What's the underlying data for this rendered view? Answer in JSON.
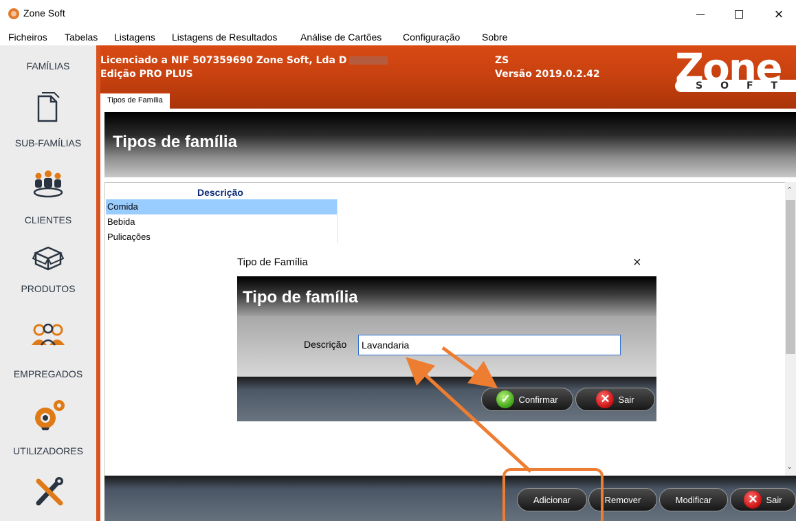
{
  "window": {
    "title": "Zone Soft",
    "controls": {
      "minimize": "minimize",
      "maximize": "maximize",
      "close": "×"
    }
  },
  "menu": [
    "Ficheiros",
    "Tabelas",
    "Listagens",
    "Listagens de Resultados",
    "Análise de Cartões",
    "Configuração",
    "Sobre"
  ],
  "sidebar": {
    "items": [
      {
        "label": "FAMÍLIAS",
        "icon": "document-icon"
      },
      {
        "label": "SUB-FAMÍLIAS",
        "icon": "group-icon"
      },
      {
        "label": "CLIENTES",
        "icon": "box-icon"
      },
      {
        "label": "PRODUTOS",
        "icon": "people-icon"
      },
      {
        "label": "EMPREGADOS",
        "icon": "gears-icon"
      },
      {
        "label": "UTILIZADORES",
        "icon": "tools-icon"
      }
    ]
  },
  "header": {
    "license_line": "Licenciado a NIF 507359690 Zone Soft, Lda D",
    "edition": "Edição PRO PLUS",
    "zs": "ZS",
    "version": "Versão 2019.0.2.42",
    "logo_word": "Zone",
    "logo_sub": "SOFT",
    "tab": "Tipos de Família",
    "accent": "#d94a14"
  },
  "main": {
    "title": "Tipos de família",
    "column": "Descrição",
    "rows": [
      "Comida",
      "Bebida",
      "Pulicações"
    ],
    "selected_index": 0
  },
  "toolbar": {
    "add": "Adicionar",
    "remove": "Remover",
    "modify": "Modificar",
    "exit": "Sair"
  },
  "dialog": {
    "window_title": "Tipo de Família",
    "close": "×",
    "title": "Tipo de família",
    "field_label": "Descrição",
    "field_value": "Lavandaria",
    "confirm": "Confirmar",
    "exit": "Sair"
  },
  "annotation_color": "#ed7d31"
}
